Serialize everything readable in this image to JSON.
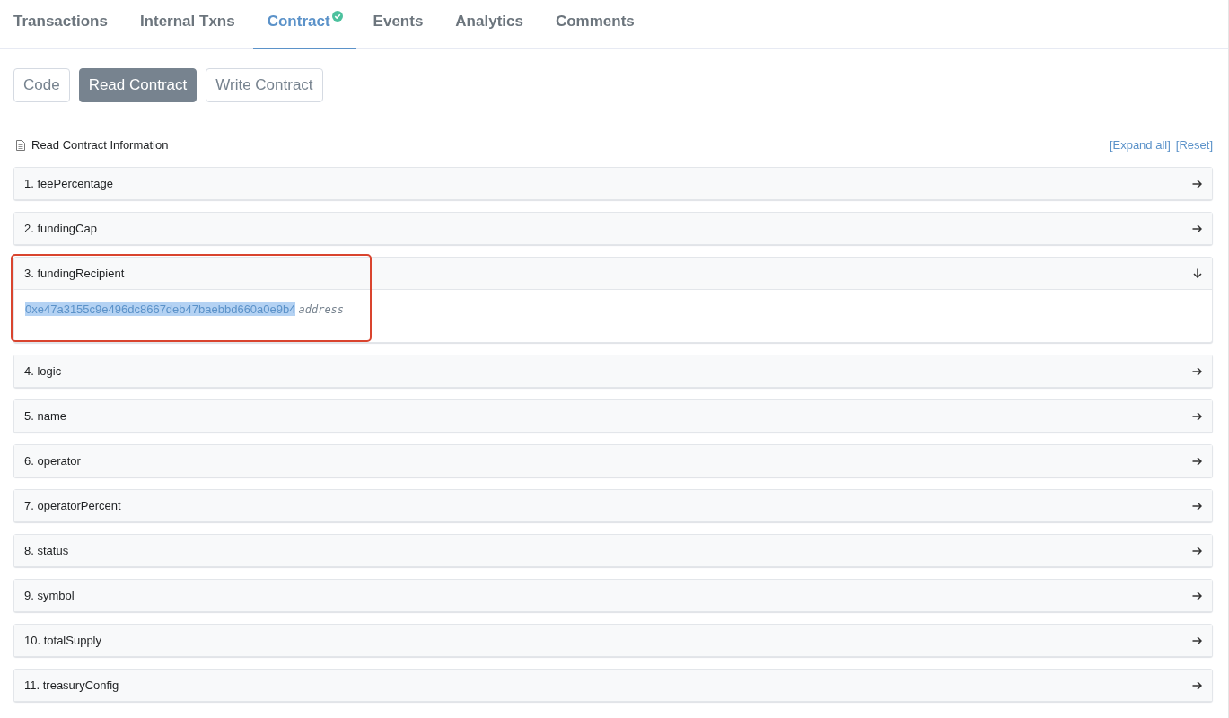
{
  "tabs": [
    {
      "label": "Transactions",
      "selected": false,
      "verified": false
    },
    {
      "label": "Internal Txns",
      "selected": false,
      "verified": false
    },
    {
      "label": "Contract",
      "selected": true,
      "verified": true
    },
    {
      "label": "Events",
      "selected": false,
      "verified": false
    },
    {
      "label": "Analytics",
      "selected": false,
      "verified": false
    },
    {
      "label": "Comments",
      "selected": false,
      "verified": false
    }
  ],
  "subtabs": [
    {
      "label": "Code",
      "selected": false
    },
    {
      "label": "Read Contract",
      "selected": true
    },
    {
      "label": "Write Contract",
      "selected": false
    }
  ],
  "section": {
    "title": "Read Contract Information",
    "links": [
      "[Expand all]",
      "[Reset]"
    ]
  },
  "functions": [
    {
      "label": "1. feePercentage",
      "expanded": false,
      "highlighted": false
    },
    {
      "label": "2. fundingCap",
      "expanded": false,
      "highlighted": false
    },
    {
      "label": "3. fundingRecipient",
      "expanded": true,
      "highlighted": true,
      "value": "0xe47a3155c9e496dc8667deb47baebbd660a0e9b4",
      "value_selected": true,
      "type": "address"
    },
    {
      "label": "4. logic",
      "expanded": false,
      "highlighted": false
    },
    {
      "label": "5. name",
      "expanded": false,
      "highlighted": false
    },
    {
      "label": "6. operator",
      "expanded": false,
      "highlighted": false
    },
    {
      "label": "7. operatorPercent",
      "expanded": false,
      "highlighted": false
    },
    {
      "label": "8. status",
      "expanded": false,
      "highlighted": false
    },
    {
      "label": "9. symbol",
      "expanded": false,
      "highlighted": false
    },
    {
      "label": "10. totalSupply",
      "expanded": false,
      "highlighted": false
    },
    {
      "label": "11. treasuryConfig",
      "expanded": false,
      "highlighted": false
    }
  ]
}
